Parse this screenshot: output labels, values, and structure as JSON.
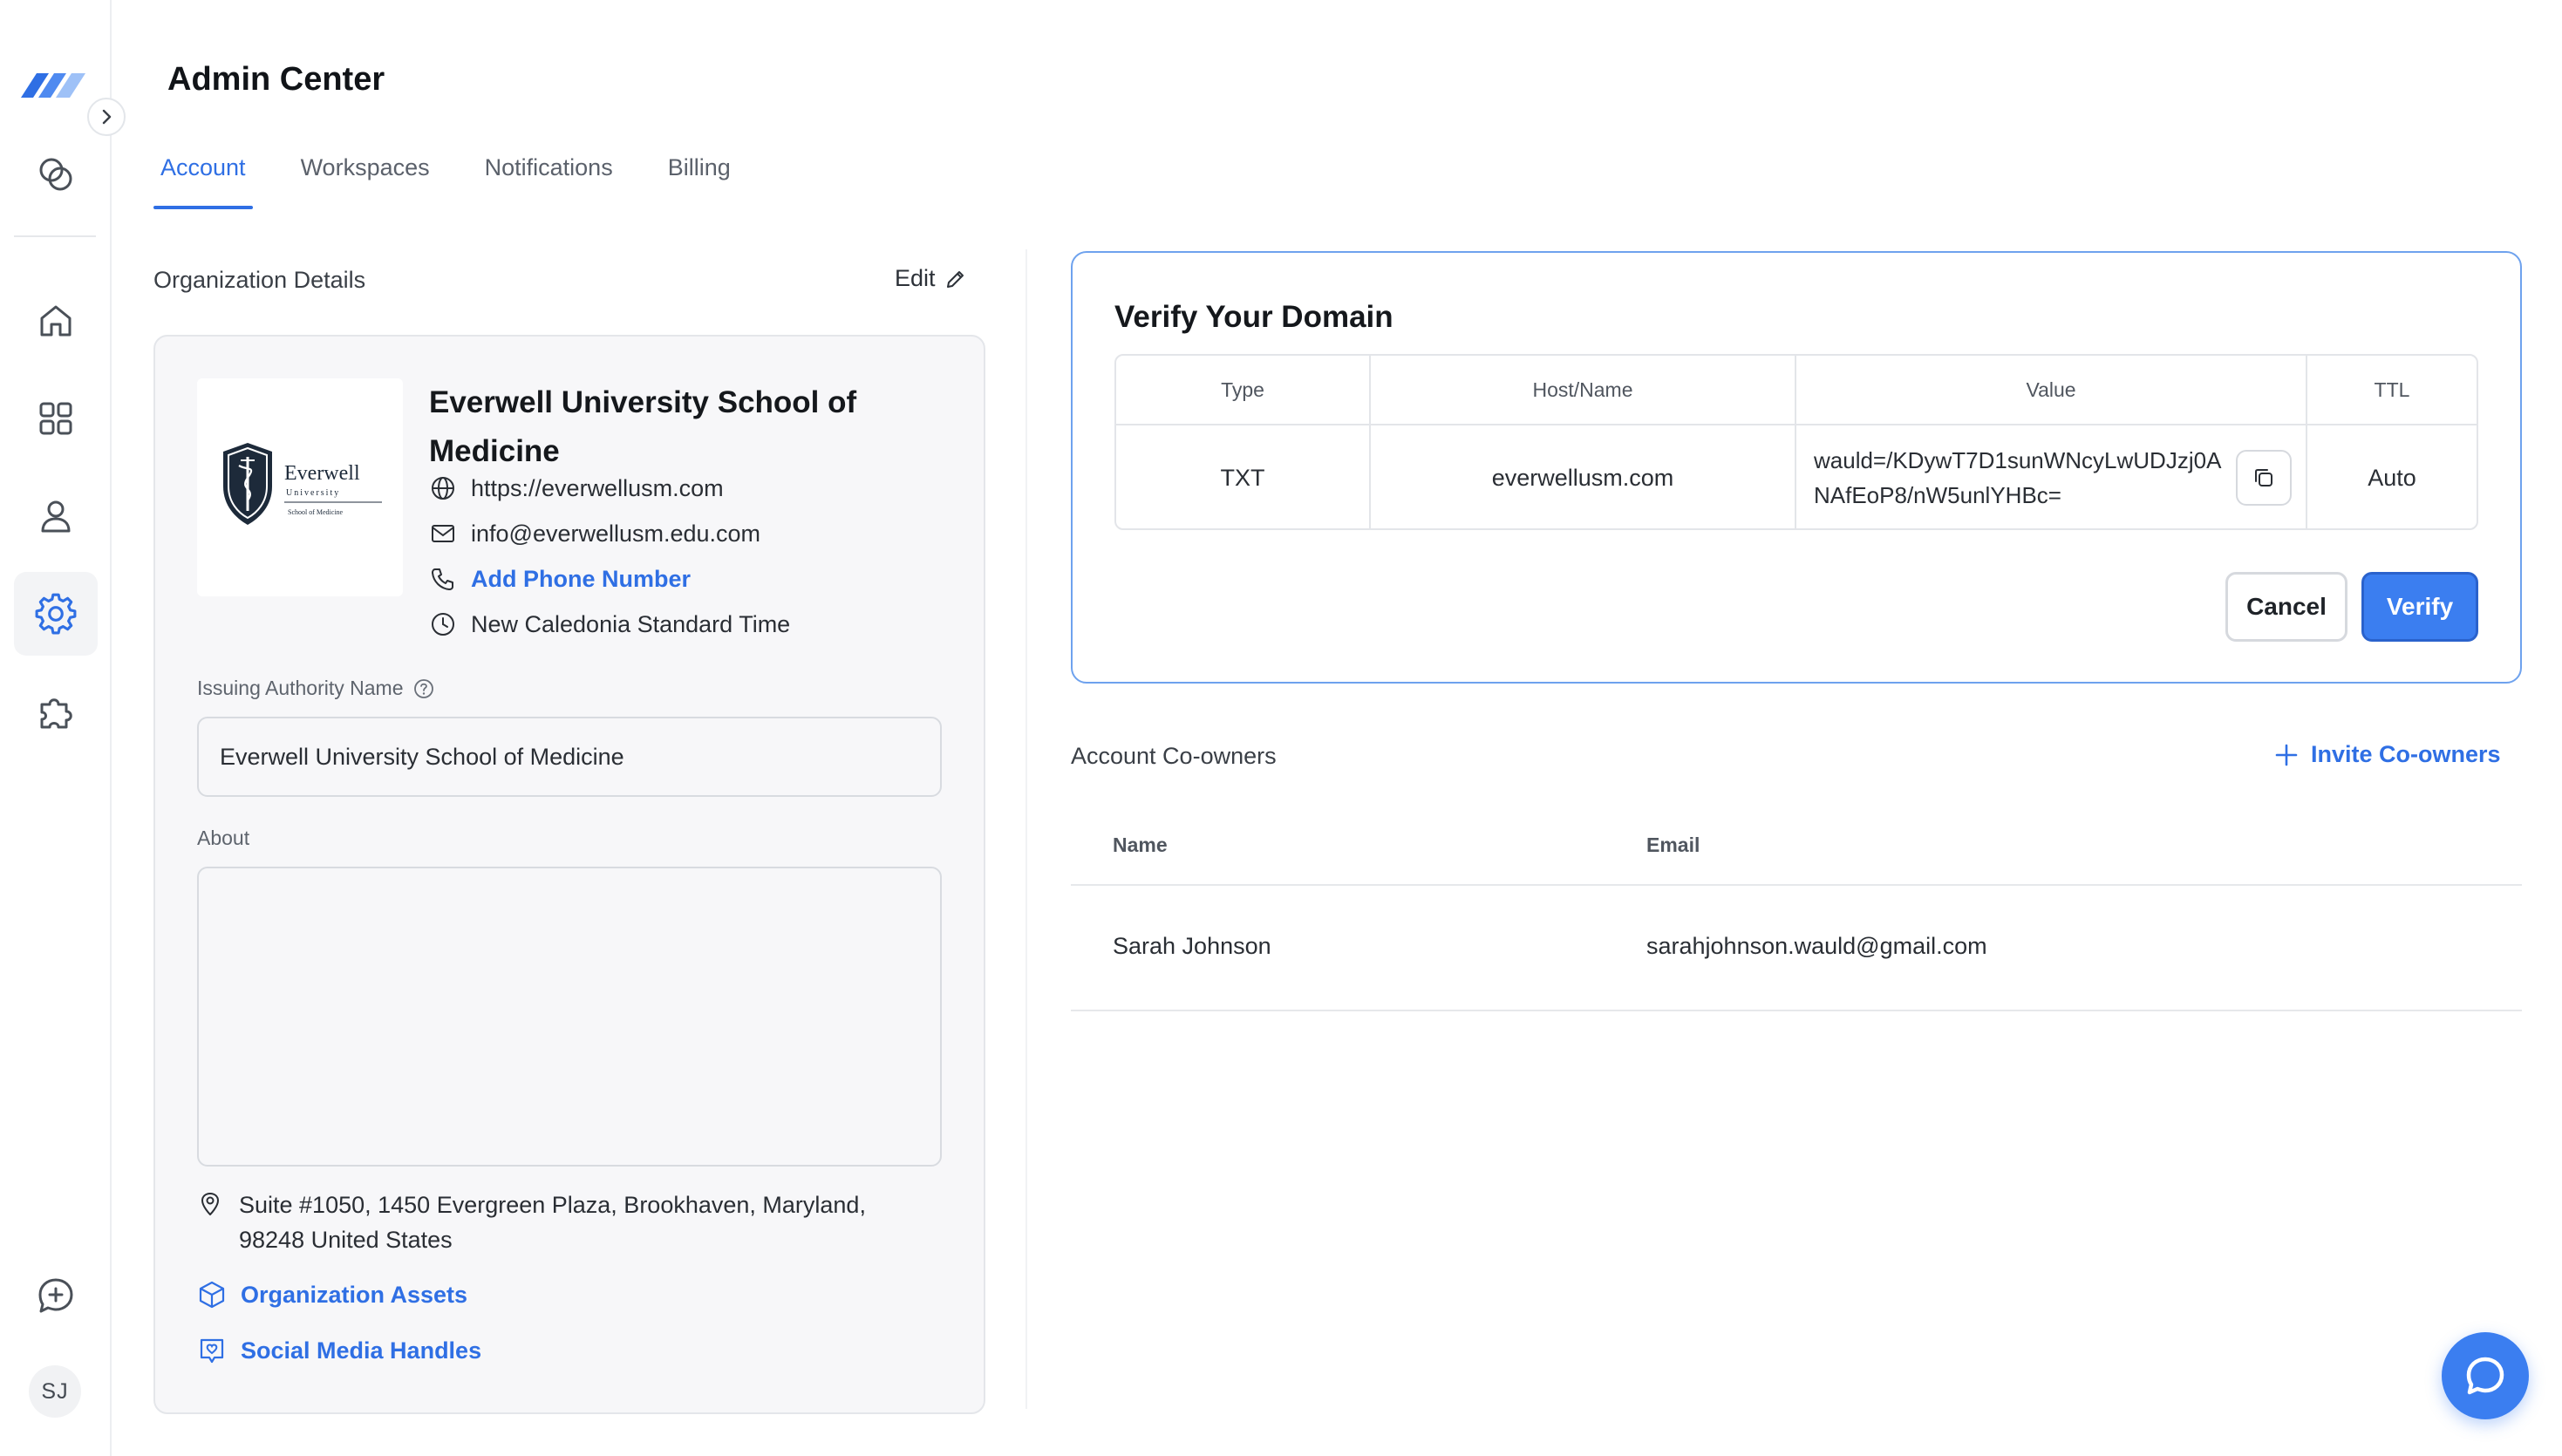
{
  "header": {
    "title": "Admin Center"
  },
  "tabs": [
    {
      "label": "Account",
      "active": true
    },
    {
      "label": "Workspaces",
      "active": false
    },
    {
      "label": "Notifications",
      "active": false
    },
    {
      "label": "Billing",
      "active": false
    }
  ],
  "sidebar": {
    "icons": [
      "circles-icon",
      "home-icon",
      "grid-icon",
      "user-icon",
      "settings-icon",
      "puzzle-icon",
      "chat-plus-icon"
    ],
    "active": "settings-icon",
    "avatar_initials": "SJ"
  },
  "org": {
    "section_title": "Organization Details",
    "edit_label": "Edit",
    "logo_text": {
      "line1": "Everwell",
      "line2": "University",
      "line3": "School of Medicine"
    },
    "name": "Everwell University School of Medicine",
    "website": "https://everwellusm.com",
    "email": "info@everwellusm.edu.com",
    "phone_link": "Add Phone Number",
    "timezone": "New Caledonia Standard Time",
    "issuing_label": "Issuing Authority Name",
    "issuing_value": "Everwell University School of Medicine",
    "about_label": "About",
    "about_value": "",
    "address": "Suite #1050, 1450 Evergreen Plaza, Brookhaven, Maryland, 98248 United States",
    "assets_link": "Organization Assets",
    "social_link": "Social Media Handles"
  },
  "verify": {
    "title": "Verify Your Domain",
    "columns": [
      "Type",
      "Host/Name",
      "Value",
      "TTL"
    ],
    "record": {
      "type": "TXT",
      "host": "everwellusm.com",
      "value": "wauld=/KDywT7D1sunWNcyLwUDJzj0ANAfEoP8/nW5unlYHBc=",
      "ttl": "Auto"
    },
    "cancel_label": "Cancel",
    "verify_label": "Verify"
  },
  "coowners": {
    "title": "Account Co-owners",
    "invite_label": "Invite Co-owners",
    "columns": [
      "Name",
      "Email"
    ],
    "rows": [
      {
        "name": "Sarah Johnson",
        "email": "sarahjohnson.wauld@gmail.com"
      }
    ]
  },
  "colors": {
    "accent": "#2f6fe4",
    "verify_border": "#6ea2ee",
    "button_primary": "#3b7ef0"
  }
}
